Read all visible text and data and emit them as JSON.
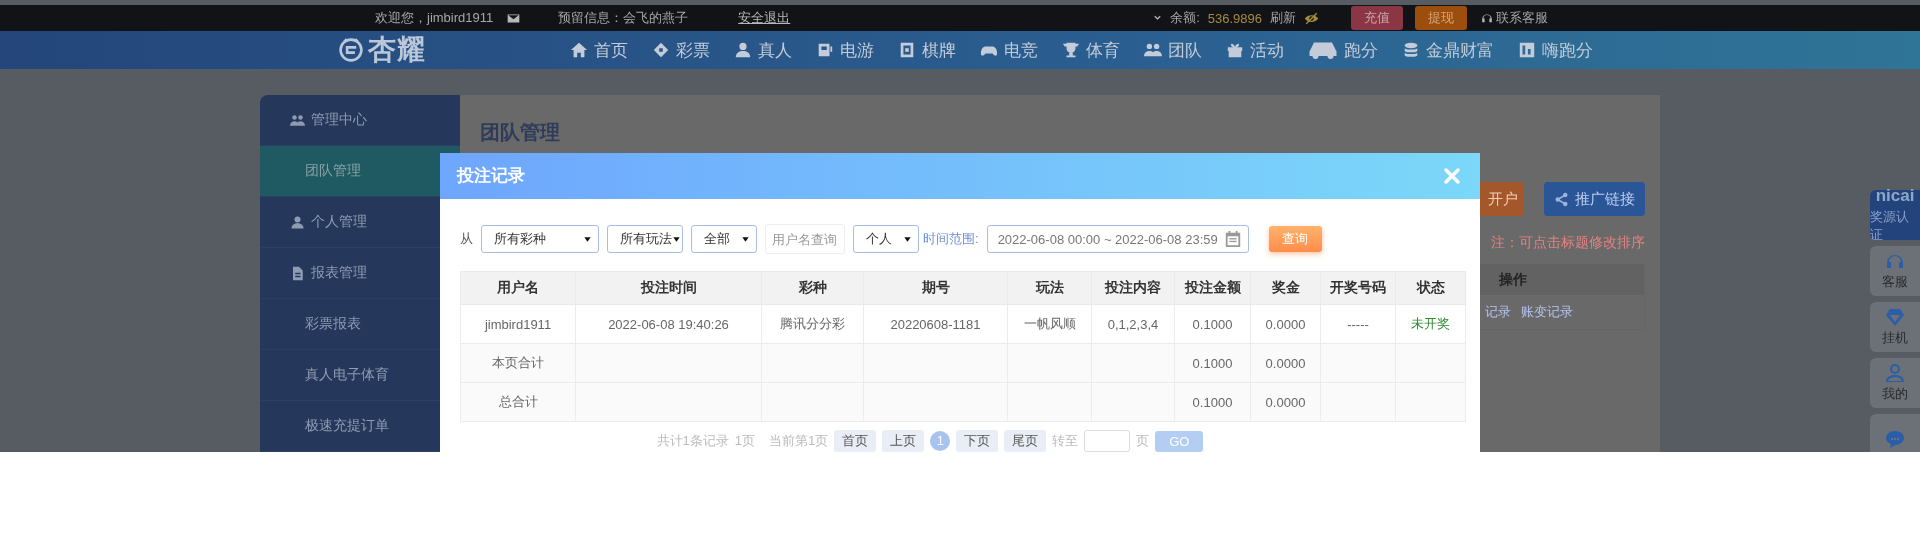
{
  "top_bar": {
    "welcome": "欢迎您，jimbird1911",
    "notice": "预留信息：会飞的燕子",
    "logout": "安全退出",
    "balance_label": "余额:",
    "balance": "536.9896",
    "refresh": "刷新",
    "deposit": "充值",
    "withdraw": "提现",
    "support": "联系客服"
  },
  "nav": {
    "logo": "杏耀",
    "items": [
      {
        "label": "首页"
      },
      {
        "label": "彩票"
      },
      {
        "label": "真人"
      },
      {
        "label": "电游"
      },
      {
        "label": "棋牌"
      },
      {
        "label": "电竞"
      },
      {
        "label": "体育"
      },
      {
        "label": "团队"
      },
      {
        "label": "活动"
      },
      {
        "label": "跑分"
      },
      {
        "label": "金鼎财富"
      },
      {
        "label": "嗨跑分"
      }
    ]
  },
  "sidebar": {
    "items": [
      {
        "label": "管理中心",
        "kind": "header",
        "selected": false
      },
      {
        "label": "团队管理",
        "kind": "sub",
        "selected": true
      },
      {
        "label": "个人管理",
        "kind": "header",
        "selected": false
      },
      {
        "label": "报表管理",
        "kind": "header",
        "selected": false
      },
      {
        "label": "彩票报表",
        "kind": "sub",
        "selected": false
      },
      {
        "label": "真人电子体育",
        "kind": "sub",
        "selected": false
      },
      {
        "label": "极速充提订单",
        "kind": "sub",
        "selected": false
      }
    ]
  },
  "page": {
    "title": "团队管理",
    "buttons": [
      {
        "label": "开户",
        "kind": "orange"
      },
      {
        "label": "推广链接",
        "kind": "blue"
      }
    ],
    "note": "注：可点击标题修改排序",
    "table": {
      "columns": [
        "操作"
      ],
      "links": [
        "记录",
        "账变记录"
      ]
    }
  },
  "float_bar": {
    "items": [
      {
        "kind": "brand",
        "brand": "nicai",
        "label": "奖源认证"
      },
      {
        "kind": "icon",
        "label": "客服"
      },
      {
        "kind": "icon",
        "label": "挂机"
      },
      {
        "kind": "icon",
        "label": "我的"
      },
      {
        "kind": "icon"
      }
    ]
  },
  "modal": {
    "title": "投注记录",
    "filters": {
      "from_label": "从",
      "lottery": "所有彩种",
      "play": "所有玩法",
      "scope": "全部",
      "username_placeholder": "用户名查询",
      "mode": "个人",
      "range_label": "时间范围:",
      "range": "2022-06-08 00:00 ~ 2022-06-08 23:59",
      "search": "查询"
    },
    "table": {
      "columns": [
        "用户名",
        "投注时间",
        "彩种",
        "期号",
        "玩法",
        "投注内容",
        "投注金额",
        "奖金",
        "开奖号码",
        "状态"
      ],
      "rows": [
        {
          "kind": "record",
          "cells": [
            "jimbird1911",
            "2022-06-08 19:40:26",
            "腾讯分分彩",
            "20220608-1181",
            "一帆风顺",
            "0,1,2,3,4",
            "0.1000",
            "0.0000",
            "-----",
            "未开奖"
          ]
        },
        {
          "kind": "total",
          "label": "本页合计",
          "amount": "0.1000",
          "prize": "0.0000"
        },
        {
          "kind": "total",
          "label": "总合计",
          "amount": "0.1000",
          "prize": "0.0000"
        }
      ]
    },
    "pagination": {
      "summary": "共计1条记录",
      "pages": "1页",
      "current": "当前第1页",
      "first": "首页",
      "prev": "上页",
      "page_numbers": [
        {
          "label": "1",
          "selected": true
        }
      ],
      "next": "下页",
      "last": "尾页",
      "goto_label": "转至",
      "page_unit": "页",
      "go": "GO"
    }
  }
}
